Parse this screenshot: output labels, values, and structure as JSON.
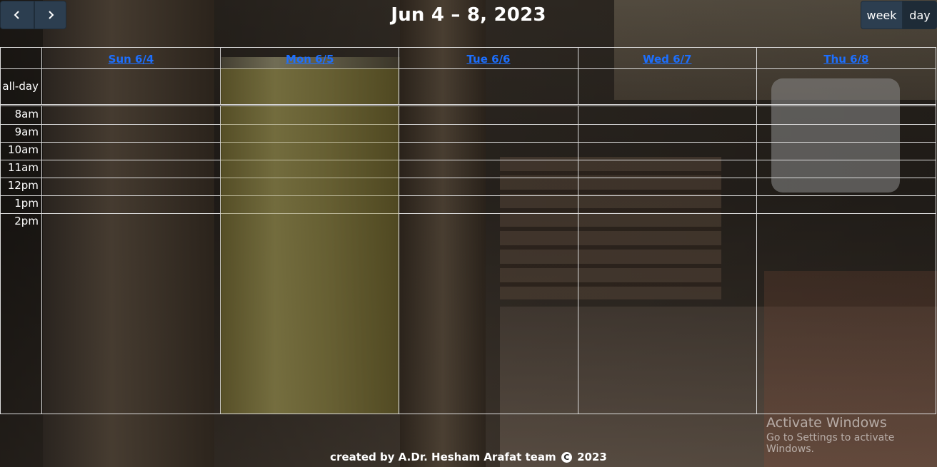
{
  "toolbar": {
    "prev_icon": "chevron-left-icon",
    "next_icon": "chevron-right-icon",
    "title": "Jun 4 – 8, 2023",
    "views": [
      "week",
      "day"
    ],
    "active_view": "day"
  },
  "calendar": {
    "days": [
      {
        "label": "Sun 6/4"
      },
      {
        "label": "Mon 6/5",
        "today": true
      },
      {
        "label": "Tue 6/6"
      },
      {
        "label": "Wed 6/7"
      },
      {
        "label": "Thu 6/8"
      }
    ],
    "allday_label": "all-day",
    "times": [
      "8am",
      "9am",
      "10am",
      "11am",
      "12pm",
      "1pm",
      "2pm"
    ]
  },
  "watermark": {
    "title": "Activate Windows",
    "subtitle": "Go to Settings to activate Windows."
  },
  "footer": {
    "prefix": "created by A.Dr. Hesham Arafat team",
    "copyright_symbol": "C",
    "year": "2023"
  },
  "colors": {
    "toolbar_button": "#2c3e50",
    "day_link": "#1c6fff",
    "today_highlight": "#786e14"
  }
}
